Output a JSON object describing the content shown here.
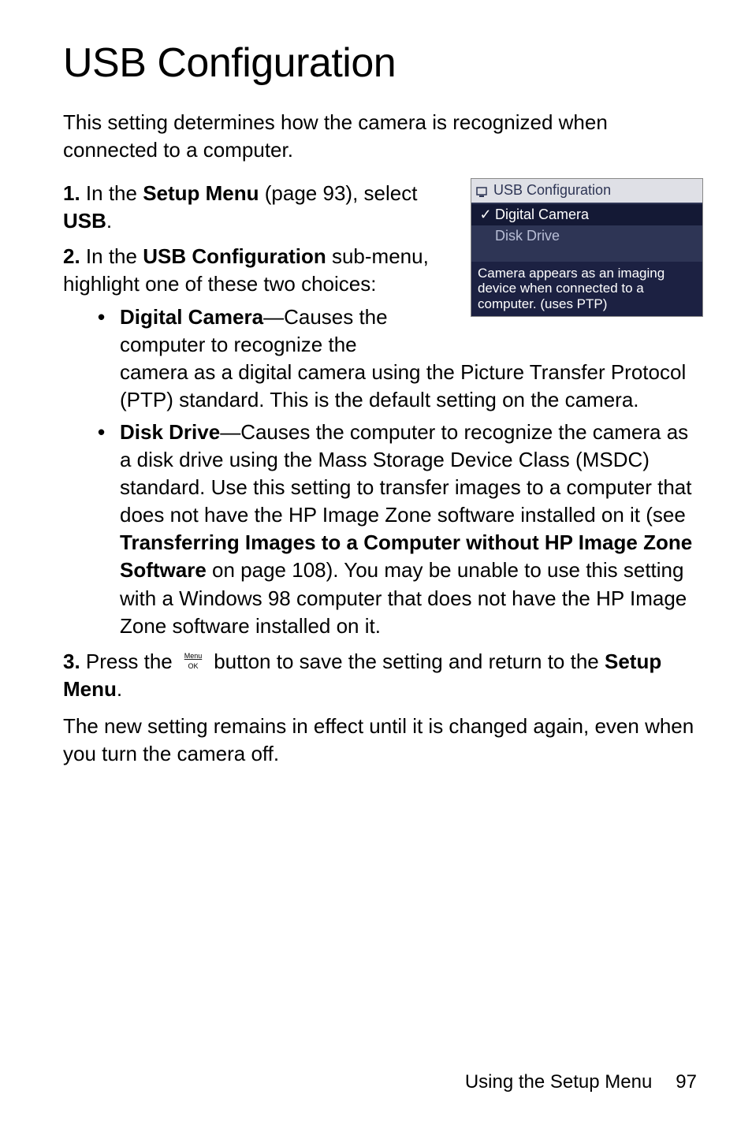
{
  "title": "USB Configuration",
  "intro": "This setting determines how the camera is recognized when connected to a computer.",
  "steps": {
    "s1_num": "1.",
    "s1_a": "In the ",
    "s1_b": "Setup Menu",
    "s1_c": " (page 93), select ",
    "s1_d": "USB",
    "s1_e": ".",
    "s2_num": "2.",
    "s2_a": "In the ",
    "s2_b": "USB Configuration",
    "s2_c": " sub-menu, highlight one of these two choices:",
    "b1_a": "Digital Camera",
    "b1_b": "—Causes the computer to recognize the",
    "b1_c": "camera as a digital camera using the Picture Transfer Protocol (PTP) standard. This is the default setting on the camera.",
    "b2_a": "Disk Drive",
    "b2_b": "—Causes the computer to recognize the camera as a disk drive using the Mass Storage Device Class (MSDC) standard. Use this setting to transfer images to a computer that does not have the HP Image Zone software installed on it (see ",
    "b2_c": "Transferring Images to a Computer without HP Image Zone Software",
    "b2_d": " on page 108). You may be unable to use this setting with a Windows 98 computer that does not have the HP Image Zone software installed on it.",
    "s3_num": "3.",
    "s3_a": "Press the ",
    "s3_b": " button to save the setting and return to the ",
    "s3_c": "Setup Menu",
    "s3_d": "."
  },
  "closing": "The new setting remains in effect until it is changed again, even when you turn the camera off.",
  "screenshot": {
    "title": "USB Configuration",
    "opt1": "Digital Camera",
    "opt2": "Disk Drive",
    "desc": "Camera appears as an imaging device when connected to a computer. (uses PTP)"
  },
  "footer": {
    "section": "Using the Setup Menu",
    "page": "97"
  },
  "icons": {
    "menu_top": "Menu",
    "menu_bottom": "OK"
  }
}
